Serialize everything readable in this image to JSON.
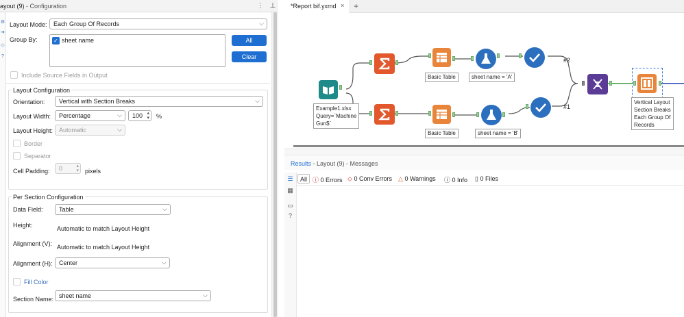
{
  "config_panel": {
    "title": "ayout (9)",
    "subtitle": " - Configuration",
    "layout_mode_label": "Layout Mode:",
    "layout_mode_value": "Each Group Of Records",
    "group_by_label": "Group By:",
    "group_by_item": "sheet name",
    "all_button": "All",
    "clear_button": "Clear",
    "include_source_label": "Include Source Fields in Output",
    "layout_config": {
      "title": "Layout Configuration",
      "orientation_label": "Orientation:",
      "orientation_value": "Vertical with Section Breaks",
      "layout_width_label": "Layout Width:",
      "layout_width_value": "Percentage",
      "width_number": "100",
      "width_unit": "%",
      "layout_height_label": "Layout Height:",
      "layout_height_value": "Automatic",
      "border_label": "Border",
      "separator_label": "Separator",
      "cell_padding_label": "Cell Padding:",
      "cell_padding_value": "0",
      "cell_padding_unit": "pixels"
    },
    "per_section": {
      "title": "Per Section Configuration",
      "data_field_label": "Data Field:",
      "data_field_value": "Table",
      "height_label": "Height:",
      "height_value": "Automatic to match Layout Height",
      "align_v_label": "Alignment (V):",
      "align_v_value": "Automatic to match Layout Height",
      "align_h_label": "Alignment (H):",
      "align_h_value": "Center",
      "fill_color_label": "Fill Color",
      "section_name_label": "Section Name:",
      "section_name_value": "sheet name"
    }
  },
  "tab": {
    "label": "*Report bif.yxmd",
    "close": "×",
    "add": "+"
  },
  "workflow": {
    "input_label_lines": [
      "Example1.xlsx",
      "Query=`Machine",
      "Gun$`"
    ],
    "basic_table_1": "Basic Table",
    "basic_table_2": "Basic Table",
    "formula_1": "sheet name = 'A'",
    "formula_2": "sheet name = 'B'",
    "union_tag_1": "#2",
    "union_tag_2": "#1",
    "layout_label_lines": [
      "Vertical Layout",
      "Section Breaks",
      "Each Group Of",
      "Records"
    ]
  },
  "results": {
    "title": "Results",
    "subtitle": " - Layout (9) - Messages",
    "filter_all": "All",
    "errors": "0 Errors",
    "conv_errors": "0 Conv Errors",
    "warnings": "0 Warnings",
    "info": "0 Info",
    "files": "0 Files"
  },
  "colors": {
    "accent_blue": "#1e6fd1",
    "summarize_orange": "#e2572b",
    "report_orange": "#e8853a",
    "input_teal": "#1f8a8a",
    "join_purple": "#5a3b96",
    "browse_blue": "#2d6fbf"
  }
}
